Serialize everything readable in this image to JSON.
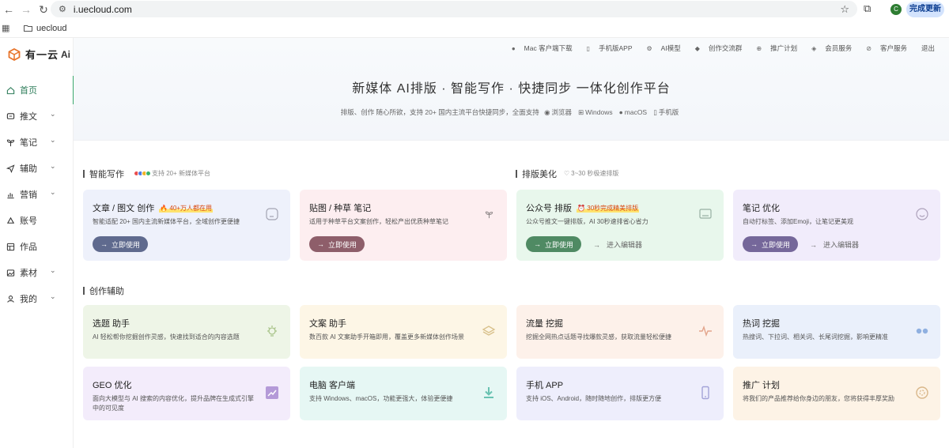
{
  "browser": {
    "url": "i.uecloud.com",
    "profile_initial": "C",
    "finish_label": "完成更新",
    "bookmark_folder": "uecloud"
  },
  "logo": {
    "text": "有一云",
    "brand_color": "#e8742a"
  },
  "sidebar": {
    "items": [
      {
        "label": "首页",
        "icon": "home-icon",
        "active": true,
        "chevron": false
      },
      {
        "label": "推文",
        "icon": "message-icon",
        "active": false,
        "chevron": true
      },
      {
        "label": "笔记",
        "icon": "sprout-icon",
        "active": false,
        "chevron": true
      },
      {
        "label": "辅助",
        "icon": "send-icon",
        "active": false,
        "chevron": true
      },
      {
        "label": "营销",
        "icon": "chart-icon",
        "active": false,
        "chevron": true
      },
      {
        "label": "账号",
        "icon": "account-icon",
        "active": false,
        "chevron": false
      },
      {
        "label": "作品",
        "icon": "grid-icon",
        "active": false,
        "chevron": false
      },
      {
        "label": "素材",
        "icon": "image-icon",
        "active": false,
        "chevron": true
      },
      {
        "label": "我的",
        "icon": "user-icon",
        "active": false,
        "chevron": true
      }
    ]
  },
  "topnav": {
    "items": [
      {
        "label": "Mac 客户端下载",
        "icon": "apple-icon"
      },
      {
        "label": "手机版APP",
        "icon": "phone-icon"
      },
      {
        "label": "AI模型",
        "icon": "gear-icon"
      },
      {
        "label": "创作交流群",
        "icon": "chat-icon"
      },
      {
        "label": "推广计划",
        "icon": "share-icon"
      },
      {
        "label": "会员服务",
        "icon": "diamond-icon"
      },
      {
        "label": "客户服务",
        "icon": "link-icon"
      },
      {
        "label": "退出",
        "icon": ""
      }
    ]
  },
  "hero": {
    "title": "新媒体 AI排版 · 智能写作 · 快捷同步 一体化创作平台",
    "subtitle_prefix": "排版、创作 随心所欲，支持 20+ 国内主流平台快捷同步，全面支持",
    "platforms": [
      {
        "label": "浏览器",
        "icon": "chrome-icon"
      },
      {
        "label": "Windows",
        "icon": "windows-icon"
      },
      {
        "label": "macOS",
        "icon": "apple-icon"
      },
      {
        "label": "手机版",
        "icon": "phone-icon"
      }
    ]
  },
  "sections": {
    "smart_writing": {
      "title": "智能写作",
      "note": "支持 20+ 新媒体平台"
    },
    "layout": {
      "title": "排版美化",
      "note": "3~30 秒极速排版"
    },
    "assist": {
      "title": "创作辅助"
    }
  },
  "top_cards": [
    {
      "title": "文章 / 图文 创作",
      "badge": "🔥 40+万人都在用",
      "desc": "智能适配 20+ 国内主流新媒体平台，全域创作更便捷",
      "button": "立即使用",
      "link": "",
      "bg": "#eef1fb",
      "btn_color": "#5f6a8e",
      "icon": "sticker-icon"
    },
    {
      "title": "贴图 / 种草 笔记",
      "badge": "",
      "desc": "适用于种草平台文案创作，轻松产出优质种草笔记",
      "button": "立即使用",
      "link": "",
      "bg": "#fdeef0",
      "btn_color": "#8e5e6a",
      "icon": "sprout-icon"
    },
    {
      "title": "公众号 排版",
      "badge": "⏰ 30秒完成精美排版",
      "desc": "公众号推文一键排版，AI 30秒速排省心省力",
      "button": "立即使用",
      "link": "进入编辑器",
      "bg": "#e8f7ec",
      "btn_color": "#4f8a63",
      "icon": "editor-icon"
    },
    {
      "title": "笔记 优化",
      "badge": "",
      "desc": "自动打标签、添加Emoji，让笔记更美观",
      "button": "立即使用",
      "link": "进入编辑器",
      "bg": "#f1ecfb",
      "btn_color": "#75679a",
      "icon": "smile-icon"
    }
  ],
  "assist_cards": [
    {
      "title": "选题 助手",
      "desc": "AI 轻松帮你挖掘创作灵感，快速找到适合的内容选题",
      "bg": "#eef5e7",
      "icon": "bulb-icon",
      "icon_color": "#a9c48a"
    },
    {
      "title": "文案 助手",
      "desc": "数百款 AI 文案助手开箱即用，覆盖更多新媒体创作场景",
      "bg": "#fdf6e6",
      "icon": "layers-icon",
      "icon_color": "#d8c08a"
    },
    {
      "title": "流量 挖掘",
      "desc": "挖掘全网热点话题寻找爆款灵感，获取流量轻松便捷",
      "bg": "#fdf1ea",
      "icon": "pulse-icon",
      "icon_color": "#e3a58c"
    },
    {
      "title": "热词 挖掘",
      "desc": "热搜词、下拉词、相关词、长尾词挖掘，影响更精准",
      "bg": "#eaf0fb",
      "icon": "dots-icon",
      "icon_color": "#8fb0e0"
    },
    {
      "title": "GEO 优化",
      "desc": "面向大模型与 AI 搜索的内容优化，提升品牌在生成式引擎中的可见度",
      "bg": "#f3ecfb",
      "icon": "trend-icon",
      "icon_color": "#b49ad8"
    },
    {
      "title": "电脑 客户端",
      "desc": "支持 Windows、macOS，功能更强大，体验更便捷",
      "bg": "#e6f7f4",
      "icon": "download-icon",
      "icon_color": "#69c2b1"
    },
    {
      "title": "手机 APP",
      "desc": "支持 iOS、Android，随时随地创作，排版更方便",
      "bg": "#eeeefc",
      "icon": "mobile-icon",
      "icon_color": "#a3a3d8"
    },
    {
      "title": "推广 计划",
      "desc": "将我们的产品推荐给你身边的朋友，您将获得丰厚奖励",
      "bg": "#fdf3e6",
      "icon": "coin-icon",
      "icon_color": "#d9b78a"
    }
  ]
}
